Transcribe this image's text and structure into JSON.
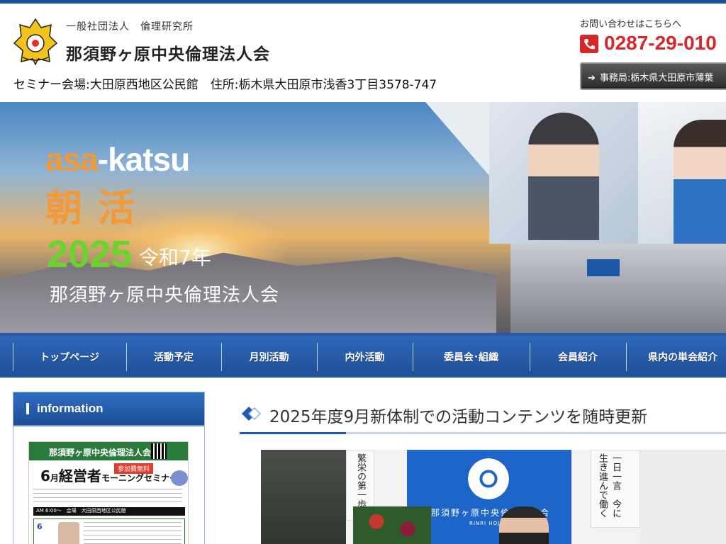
{
  "header": {
    "org_sub": "一般社団法人　倫理研究所",
    "org_name": "那須野ヶ原中央倫理法人会",
    "venue": "セミナー会場:大田原西地区公民館　住所:栃木県大田原市浅香3丁目3578-747",
    "contact_label": "お問い合わせはこちらへ",
    "phone": "0287-29-010",
    "office_button": "事務局:栃木県大田原市薄葉"
  },
  "hero": {
    "title_en_a": "asa",
    "title_en_b": "-katsu",
    "title_jp": "朝活",
    "year": "2025",
    "era": "令和7年",
    "org": "那須野ヶ原中央倫理法人会"
  },
  "nav": {
    "items": [
      "トップページ",
      "活動予定",
      "月別活動",
      "内外活動",
      "委員会･組織",
      "会員紹介",
      "県内の単会紹介"
    ]
  },
  "sidebar": {
    "title": "information",
    "flyer": {
      "head": "那須野ヶ原中央倫理法人会",
      "badge": "参加費無料",
      "month": "6",
      "title_a": "月",
      "title_b": "経営者",
      "title_c": "モーニングセミナー",
      "time": "AM 6:00～　会場　大田原西地区公民館",
      "date": "6"
    }
  },
  "main": {
    "heading": "2025年度9月新体制での活動コンテンツを随時更新",
    "photo": {
      "banner_text": "那須野ヶ原中央倫理法人会",
      "banner_sub": "RINRI HOJINKAI",
      "scroll_left": "繁栄の第一歩",
      "scroll_right": "一日一言　今に生き進んで働く"
    }
  },
  "colors": {
    "brand_blue": "#1b4f9c",
    "phone_red": "#d6282b",
    "accent_orange": "#f39a36",
    "accent_green": "#6bd22e"
  },
  "icons": {
    "phone": "phone-icon",
    "arrow": "arrow-right-icon",
    "heading": "diamond-icon",
    "logo": "emblem-logo"
  }
}
